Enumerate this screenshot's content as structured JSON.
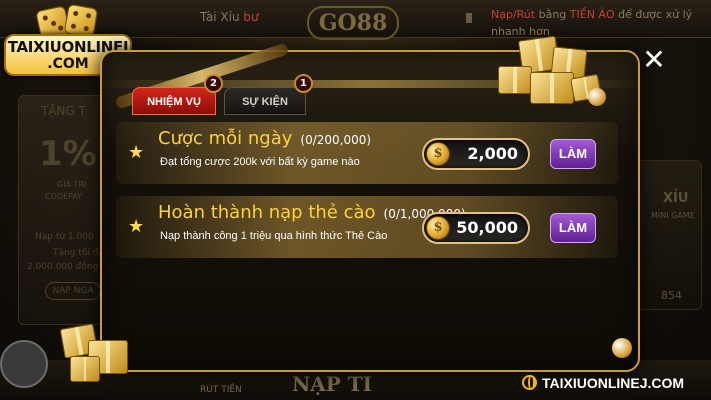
{
  "brand": {
    "name": "TAIXIUONLINEJ",
    "tld": ".COM",
    "footer_url": "TAIXIUONLINEJ.COM"
  },
  "background": {
    "top_left_text": "Tài Xỉu",
    "top_left_text_suffix": "bư",
    "logo": "GO88",
    "notice_part1": "Nạp/Rút",
    "notice_part2": "bằng",
    "notice_highlight": "TIỀN ẢO",
    "notice_part3": "để được xử lý nhanh hơn",
    "left_card_title": "TẶNG T",
    "left_card_percent": "1%",
    "left_card_line1": "GIÁ TRỊ",
    "left_card_line2": "CODEPAY",
    "left_card_line3": "Nạp từ 1.000",
    "left_card_line4": "Tặng tối đa",
    "left_card_line5": "2.000.000 đồng",
    "left_card_button": "NẠP NGA",
    "right_card_title": "XỈU",
    "right_card_sub": "MINI GAME",
    "right_card_value": "854",
    "bottom_left": "RÚT TIỀN",
    "bottom_center": "NẠP TI",
    "accent": "#e23b2e"
  },
  "modal": {
    "tabs": [
      {
        "label": "NHIỆM VỤ",
        "badge": "2",
        "active": true
      },
      {
        "label": "SỰ KIỆN",
        "badge": "1",
        "active": false
      }
    ],
    "tasks": [
      {
        "title": "Cược mỗi ngày",
        "progress": "(0/200,000)",
        "description": "Đạt tổng cược 200k với bất kỳ game nào",
        "reward": "2,000",
        "action": "LÀM"
      },
      {
        "title": "Hoàn thành nạp thẻ cào",
        "progress": "(0/1,000,000)",
        "description": "Nạp thành công 1 triệu qua hình thức Thẻ Cào",
        "reward": "50,000",
        "action": "LÀM"
      }
    ],
    "close_icon": "close-icon"
  },
  "colors": {
    "gold": "#ffd23c",
    "tab_active": "#d2271c",
    "action_button": "#8b3fbf",
    "frame": "#c99a3e"
  }
}
